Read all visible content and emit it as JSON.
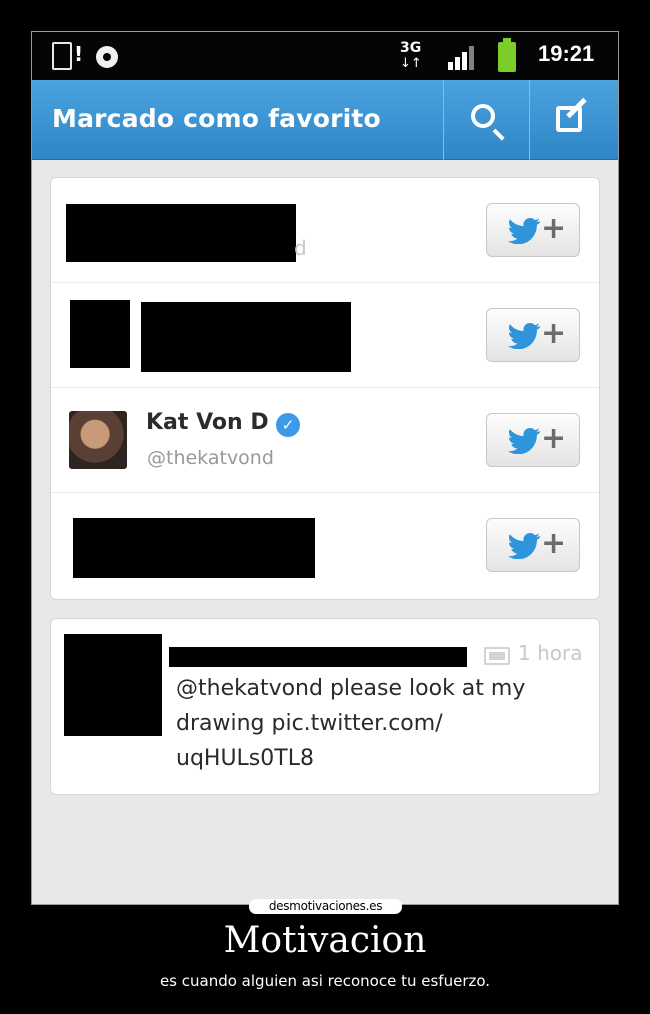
{
  "status_bar": {
    "network": "3G",
    "network_arrows": "↓↑",
    "time": "19:21",
    "icons": [
      "sim-alert-icon",
      "sync-icon",
      "signal-icon",
      "battery-icon"
    ]
  },
  "action_bar": {
    "title": "Marcado como favorito",
    "icons": [
      "search-icon",
      "compose-icon"
    ],
    "color": "#3a95d6"
  },
  "users": [
    {
      "redacted": true,
      "residual_text": "d"
    },
    {
      "redacted": true
    },
    {
      "name": "Kat Von D",
      "handle": "@thekatvond",
      "verified": true
    },
    {
      "redacted": true
    }
  ],
  "follow_button": {
    "plus": "+",
    "icon": "twitter-bird-icon",
    "bird_color": "#2e95da"
  },
  "tweet": {
    "author_redacted": true,
    "time": "1 hora",
    "text": "@thekatvond please look at my drawing pic.twitter.com/ uqHULs0TL8"
  },
  "poster": {
    "watermark": "desmotivaciones.es",
    "title": "Motivacion",
    "subtitle": "es cuando alguien asi reconoce tu esfuerzo."
  }
}
